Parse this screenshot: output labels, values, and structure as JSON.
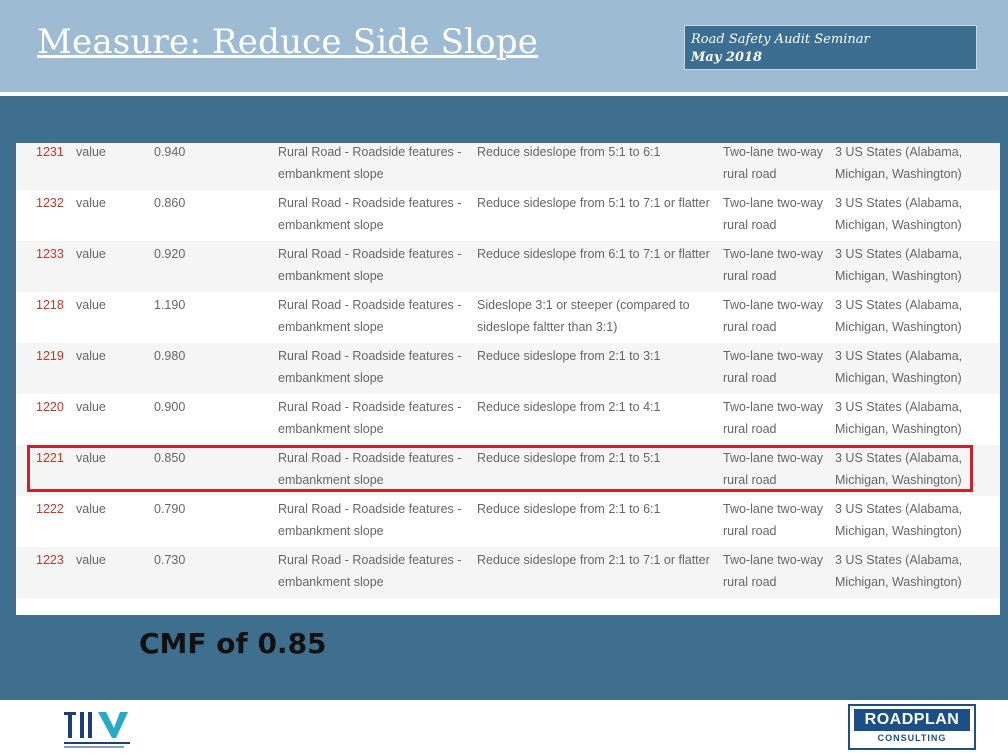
{
  "header": {
    "title": "Measure: Reduce Side Slope",
    "seminar_line": "Road Safety Audit Seminar",
    "seminar_date": "May 2018"
  },
  "table": {
    "rows": [
      {
        "id": "1231",
        "kind": "value",
        "value": "0.940",
        "category_1": "Rural Road - Roadside features -",
        "category_2": "embankment slope",
        "desc_1": "Reduce sideslope from 5:1 to 6:1",
        "desc_2": "",
        "area_1": "Two-lane two-way",
        "area_2": "rural road",
        "state_1": "3 US States (Alabama,",
        "state_2": "Michigan, Washington)"
      },
      {
        "id": "1232",
        "kind": "value",
        "value": "0.860",
        "category_1": "Rural Road - Roadside features -",
        "category_2": "embankment slope",
        "desc_1": "Reduce sideslope from 5:1 to 7:1 or flatter",
        "desc_2": "",
        "area_1": "Two-lane two-way",
        "area_2": "rural road",
        "state_1": "3 US States (Alabama,",
        "state_2": "Michigan, Washington)"
      },
      {
        "id": "1233",
        "kind": "value",
        "value": "0.920",
        "category_1": "Rural Road - Roadside features -",
        "category_2": "embankment slope",
        "desc_1": "Reduce sideslope from 6:1 to 7:1 or flatter",
        "desc_2": "",
        "area_1": "Two-lane two-way",
        "area_2": "rural road",
        "state_1": "3 US States (Alabama,",
        "state_2": "Michigan, Washington)"
      },
      {
        "id": "1218",
        "kind": "value",
        "value": "1.190",
        "category_1": "Rural Road - Roadside features -",
        "category_2": "embankment slope",
        "desc_1": "Sideslope 3:1 or steeper (compared to",
        "desc_2": "sideslope faltter than 3:1)",
        "area_1": "Two-lane two-way",
        "area_2": "rural road",
        "state_1": "3 US States (Alabama,",
        "state_2": "Michigan, Washington)"
      },
      {
        "id": "1219",
        "kind": "value",
        "value": "0.980",
        "category_1": "Rural Road - Roadside features -",
        "category_2": "embankment slope",
        "desc_1": "Reduce sideslope from 2:1 to 3:1",
        "desc_2": "",
        "area_1": "Two-lane two-way",
        "area_2": "rural road",
        "state_1": "3 US States (Alabama,",
        "state_2": "Michigan, Washington)"
      },
      {
        "id": "1220",
        "kind": "value",
        "value": "0.900",
        "category_1": "Rural Road - Roadside features -",
        "category_2": "embankment slope",
        "desc_1": "Reduce sideslope from 2:1 to 4:1",
        "desc_2": "",
        "area_1": "Two-lane two-way",
        "area_2": "rural road",
        "state_1": "3 US States (Alabama,",
        "state_2": "Michigan, Washington)"
      },
      {
        "id": "1221",
        "kind": "value",
        "value": "0.850",
        "category_1": "Rural Road - Roadside features -",
        "category_2": "embankment slope",
        "desc_1": "Reduce sideslope from 2:1 to 5:1",
        "desc_2": "",
        "area_1": "Two-lane two-way",
        "area_2": "rural road",
        "state_1": "3 US States (Alabama,",
        "state_2": "Michigan, Washington)"
      },
      {
        "id": "1222",
        "kind": "value",
        "value": "0.790",
        "category_1": "Rural Road - Roadside features -",
        "category_2": "embankment slope",
        "desc_1": "Reduce sideslope from 2:1 to 6:1",
        "desc_2": "",
        "area_1": "Two-lane two-way",
        "area_2": "rural road",
        "state_1": "3 US States (Alabama,",
        "state_2": "Michigan, Washington)"
      },
      {
        "id": "1223",
        "kind": "value",
        "value": "0.730",
        "category_1": "Rural Road - Roadside features -",
        "category_2": "embankment slope",
        "desc_1": "Reduce sideslope from 2:1 to 7:1 or flatter",
        "desc_2": "",
        "area_1": "Two-lane two-way",
        "area_2": "rural road",
        "state_1": "3 US States (Alabama,",
        "state_2": "Michigan, Washington)"
      }
    ]
  },
  "callout": "CMF of 0.85",
  "footer": {
    "roadplan_name": "ROADPLAN",
    "roadplan_sub": "CONSULTING"
  },
  "colors": {
    "header_bg": "#9dbcd3",
    "panel_bg": "#3f6f8f",
    "highlight": "#c8232c",
    "id_text": "#c0392b"
  }
}
